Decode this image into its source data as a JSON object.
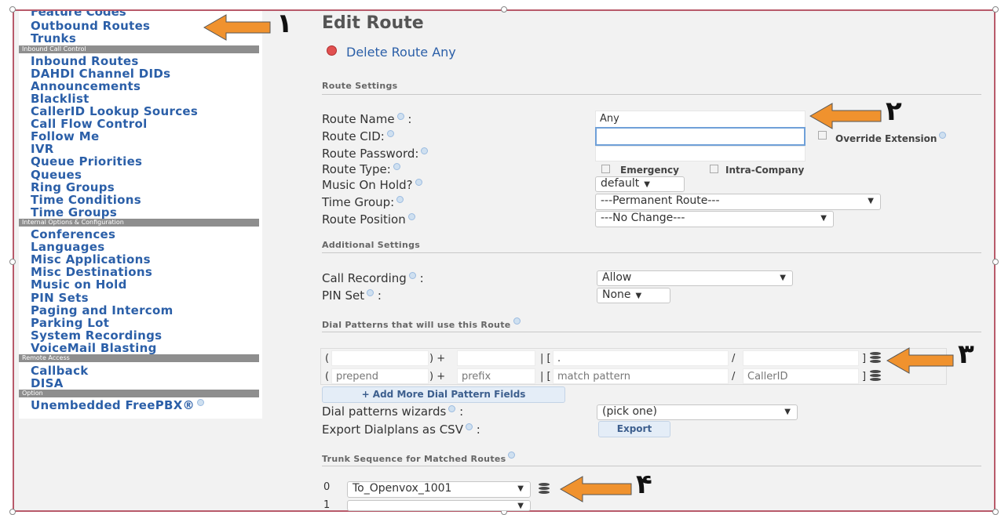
{
  "sidebar": {
    "top_cut_label": "Feature Codes",
    "items": [
      {
        "label": "Outbound Routes"
      },
      {
        "label": "Trunks"
      },
      {
        "header": "Inbound Call Control"
      },
      {
        "label": "Inbound Routes"
      },
      {
        "label": "DAHDI Channel DIDs"
      },
      {
        "label": "Announcements"
      },
      {
        "label": "Blacklist"
      },
      {
        "label": "CallerID Lookup Sources"
      },
      {
        "label": "Call Flow Control"
      },
      {
        "label": "Follow Me"
      },
      {
        "label": "IVR"
      },
      {
        "label": "Queue Priorities"
      },
      {
        "label": "Queues"
      },
      {
        "label": "Ring Groups"
      },
      {
        "label": "Time Conditions"
      },
      {
        "label": "Time Groups"
      },
      {
        "header": "Internal Options & Configuration"
      },
      {
        "label": "Conferences"
      },
      {
        "label": "Languages"
      },
      {
        "label": "Misc Applications"
      },
      {
        "label": "Misc Destinations"
      },
      {
        "label": "Music on Hold"
      },
      {
        "label": "PIN Sets"
      },
      {
        "label": "Paging and Intercom"
      },
      {
        "label": "Parking Lot"
      },
      {
        "label": "System Recordings"
      },
      {
        "label": "VoiceMail Blasting"
      },
      {
        "header": "Remote Access"
      },
      {
        "label": "Callback"
      },
      {
        "label": "DISA"
      },
      {
        "header": "Option"
      },
      {
        "label": "Unembedded FreePBX®"
      }
    ]
  },
  "main": {
    "title": "Edit Route",
    "delete_label": "Delete Route Any",
    "route_settings": {
      "heading": "Route Settings",
      "route_name_label": "Route Name",
      "route_name_value": "Any",
      "route_cid_label": "Route CID:",
      "route_cid_value": "",
      "override_extension_label": "Override Extension",
      "route_password_label": "Route Password:",
      "route_type_label": "Route Type:",
      "emergency_label": "Emergency",
      "intra_company_label": "Intra-Company",
      "music_on_hold_label": "Music On Hold?",
      "music_on_hold_value": "default",
      "time_group_label": "Time Group:",
      "time_group_value": "---Permanent Route---",
      "route_position_label": "Route Position",
      "route_position_value": "---No Change---"
    },
    "additional_settings": {
      "heading": "Additional Settings",
      "call_recording_label": "Call Recording",
      "call_recording_value": "Allow",
      "pin_set_label": "PIN Set",
      "pin_set_value": "None"
    },
    "dial_patterns": {
      "heading": "Dial Patterns that will use this Route",
      "row1": {
        "prepend": "",
        "prefix": "",
        "match": ".",
        "callerid": ""
      },
      "row2": {
        "prepend": "prepend",
        "prefix": "prefix",
        "match": "match pattern",
        "callerid": "CallerID"
      },
      "add_button_label": "+ Add More Dial Pattern Fields",
      "wizards_label": "Dial patterns wizards",
      "wizards_value": "(pick one)",
      "export_label": "Export Dialplans as CSV",
      "export_button_label": "Export"
    },
    "trunk_sequence": {
      "heading": "Trunk Sequence for Matched Routes",
      "rows": [
        {
          "index": "0",
          "value": "To_Openvox_1001"
        },
        {
          "index": "1",
          "value": ""
        }
      ]
    }
  },
  "annotations": {
    "arrow1_num": "۱",
    "arrow2_num": "۲",
    "arrow3_num": "۳",
    "arrow4_num": "۴",
    "arrow_color": "#f0922e"
  }
}
